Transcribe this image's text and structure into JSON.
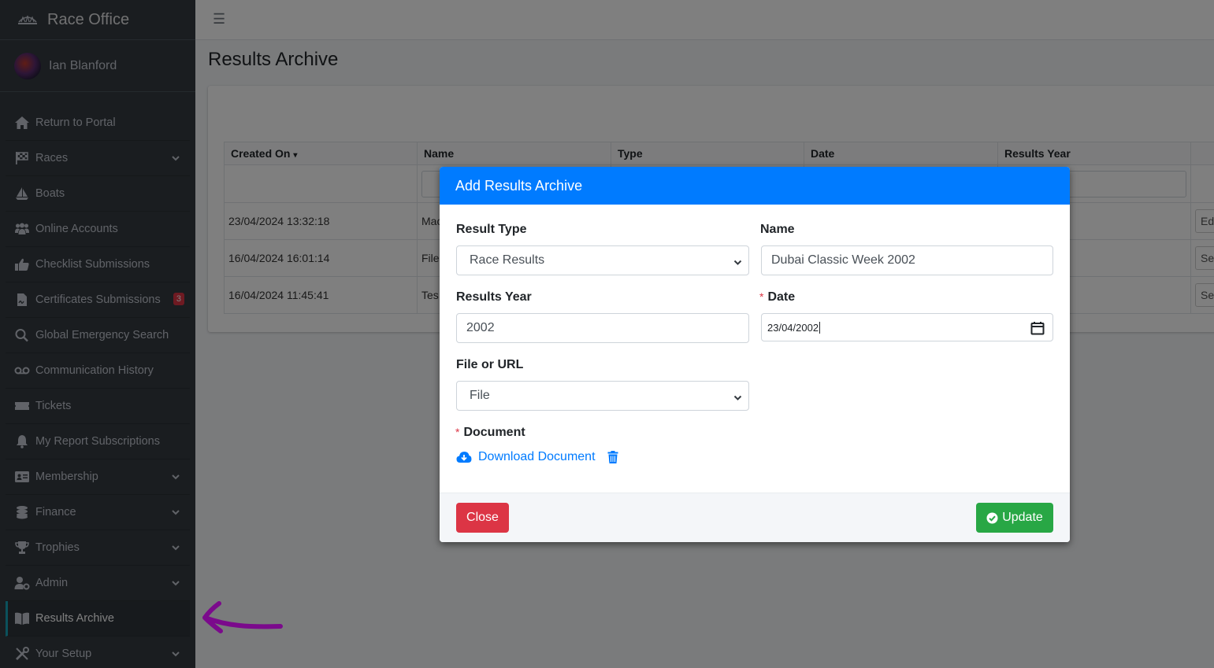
{
  "app": {
    "title": "Race Office"
  },
  "user": {
    "name": "Ian Blanford"
  },
  "sidebar": {
    "items": [
      {
        "label": "Return to Portal",
        "icon": "home-icon",
        "has_submenu": false
      },
      {
        "label": "Races",
        "icon": "checkered-flag-icon",
        "has_submenu": true
      },
      {
        "label": "Boats",
        "icon": "sailboat-icon",
        "has_submenu": false
      },
      {
        "label": "Online Accounts",
        "icon": "users-icon",
        "has_submenu": false
      },
      {
        "label": "Checklist Submissions",
        "icon": "thumbs-up-icon",
        "has_submenu": false
      },
      {
        "label": "Certificates Submissions",
        "icon": "file-signature-icon",
        "has_submenu": false,
        "badge": "3"
      },
      {
        "label": "Global Emergency Search",
        "icon": "search-icon",
        "has_submenu": false
      },
      {
        "label": "Communication History",
        "icon": "voicemail-icon",
        "has_submenu": false
      },
      {
        "label": "Tickets",
        "icon": "ticket-icon",
        "has_submenu": false
      },
      {
        "label": "My Report Subscriptions",
        "icon": "bell-icon",
        "has_submenu": false
      },
      {
        "label": "Membership",
        "icon": "id-card-icon",
        "has_submenu": true
      },
      {
        "label": "Finance",
        "icon": "coins-icon",
        "has_submenu": true
      },
      {
        "label": "Trophies",
        "icon": "trophy-icon",
        "has_submenu": true
      },
      {
        "label": "Admin",
        "icon": "user-cog-icon",
        "has_submenu": true
      },
      {
        "label": "Results Archive",
        "icon": "book-open-icon",
        "has_submenu": false,
        "active": true
      },
      {
        "label": "Your Setup",
        "icon": "tools-icon",
        "has_submenu": true
      }
    ]
  },
  "page": {
    "title": "Results Archive"
  },
  "table": {
    "columns": [
      "Created On",
      "Name",
      "Type",
      "Date",
      "Results Year"
    ],
    "sort_column": "Created On",
    "rows": [
      {
        "created_on": "23/04/2024 13:32:18",
        "name": "Mac",
        "action": "Ed"
      },
      {
        "created_on": "16/04/2024 16:01:14",
        "name": "File",
        "action": "Se"
      },
      {
        "created_on": "16/04/2024 11:45:41",
        "name": "Tes",
        "action": "Se"
      }
    ]
  },
  "modal": {
    "title": "Add Results Archive",
    "result_type": {
      "label": "Result Type",
      "value": "Race Results"
    },
    "name": {
      "label": "Name",
      "value": "Dubai Classic Week 2002"
    },
    "results_year": {
      "label": "Results Year",
      "value": "2002"
    },
    "date": {
      "label": "Date",
      "value": "23/04/2002",
      "required": true
    },
    "file_or_url": {
      "label": "File or URL",
      "value": "File"
    },
    "document": {
      "label": "Document",
      "required": true,
      "link_text": "Download Document"
    },
    "close_label": "Close",
    "update_label": "Update"
  },
  "colors": {
    "sidebar_bg": "#343a40",
    "primary": "#007bff",
    "danger": "#dc3545",
    "success": "#28a745",
    "annotation": "#7b0a8c"
  }
}
